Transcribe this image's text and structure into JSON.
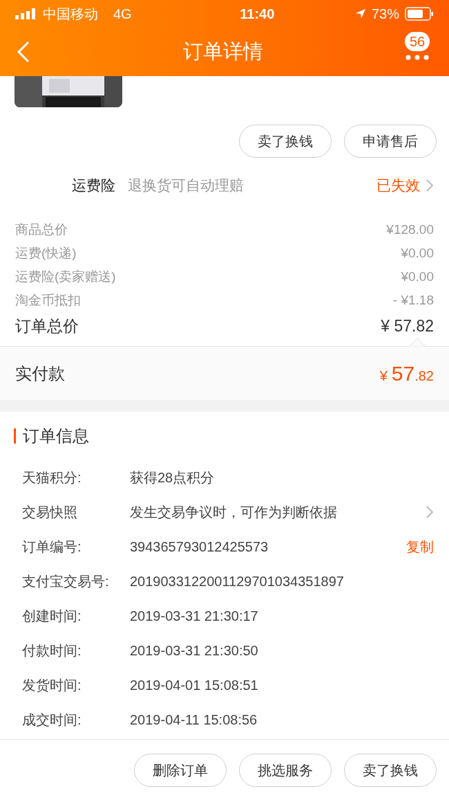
{
  "status_bar": {
    "carrier": "中国移动",
    "network": "4G",
    "time": "11:40",
    "battery": "73%"
  },
  "header": {
    "title": "订单详情",
    "badge": "56"
  },
  "top_actions": [
    "卖了换钱",
    "申请售后"
  ],
  "insurance": {
    "label": "运费险",
    "description": "退换货可自动理赔",
    "status": "已失效"
  },
  "price_rows": [
    {
      "kind": "item",
      "label": "商品总价",
      "value": "¥128.00"
    },
    {
      "kind": "item",
      "label": "运费(快递)",
      "value": "¥0.00"
    },
    {
      "kind": "item",
      "label": "运费险(卖家赠送)",
      "value": "¥0.00"
    },
    {
      "kind": "item",
      "label": "淘金币抵扣",
      "value": "- ¥1.18"
    },
    {
      "kind": "total",
      "label": "订单总价",
      "value": "¥ 57.82"
    }
  ],
  "paid": {
    "label": "实付款",
    "currency": "¥",
    "integer": "57",
    "decimal": ".82"
  },
  "order_info": {
    "title": "订单信息",
    "rows": [
      {
        "kind": "plain",
        "label": "天猫积分:",
        "value": "获得28点积分"
      },
      {
        "kind": "link",
        "label": "交易快照",
        "value": "发生交易争议时，可作为判断依据"
      },
      {
        "kind": "copy",
        "label": "订单编号:",
        "value": "394365793012425573",
        "action": "复制"
      },
      {
        "kind": "plain",
        "label": "支付宝交易号:",
        "value": "2019033122001129701034351897"
      },
      {
        "kind": "plain",
        "label": "创建时间:",
        "value": "2019-03-31 21:30:17"
      },
      {
        "kind": "plain",
        "label": "付款时间:",
        "value": "2019-03-31 21:30:50"
      },
      {
        "kind": "plain",
        "label": "发货时间:",
        "value": "2019-04-01 15:08:51"
      },
      {
        "kind": "plain",
        "label": "成交时间:",
        "value": "2019-04-11 15:08:56"
      }
    ]
  },
  "bottom_actions": [
    "删除订单",
    "挑选服务",
    "卖了换钱"
  ]
}
